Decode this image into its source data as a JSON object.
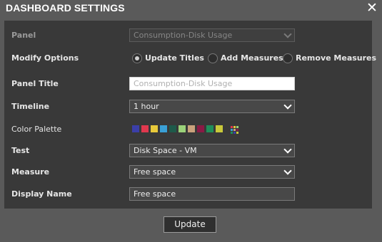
{
  "dialog": {
    "title": "DASHBOARD SETTINGS",
    "close_glyph": "✕"
  },
  "form": {
    "panel": {
      "label": "Panel",
      "value": "Consumption-Disk Usage"
    },
    "modify_options": {
      "label": "Modify Options",
      "options": [
        {
          "label": "Update Titles",
          "checked": true
        },
        {
          "label": "Add Measures",
          "checked": false
        },
        {
          "label": "Remove Measures",
          "checked": false
        }
      ]
    },
    "panel_title": {
      "label": "Panel Title",
      "placeholder": "Consumption-Disk Usage"
    },
    "timeline": {
      "label": "Timeline",
      "value": "1 hour"
    },
    "color_palette": {
      "label": "Color Palette",
      "swatches": [
        "#3b3fa8",
        "#e0384e",
        "#e8c93a",
        "#3aa0d6",
        "#1e5a4a",
        "#9bd27a",
        "#c9a27c",
        "#8a1a45",
        "#1f8f5a",
        "#c9c93a"
      ],
      "more_icon": "palette-grid-icon"
    },
    "test": {
      "label": "Test",
      "value": "Disk Space - VM"
    },
    "measure": {
      "label": "Measure",
      "value": "Free space"
    },
    "display_name": {
      "label": "Display Name",
      "value": "Free space"
    }
  },
  "footer": {
    "update_label": "Update"
  }
}
